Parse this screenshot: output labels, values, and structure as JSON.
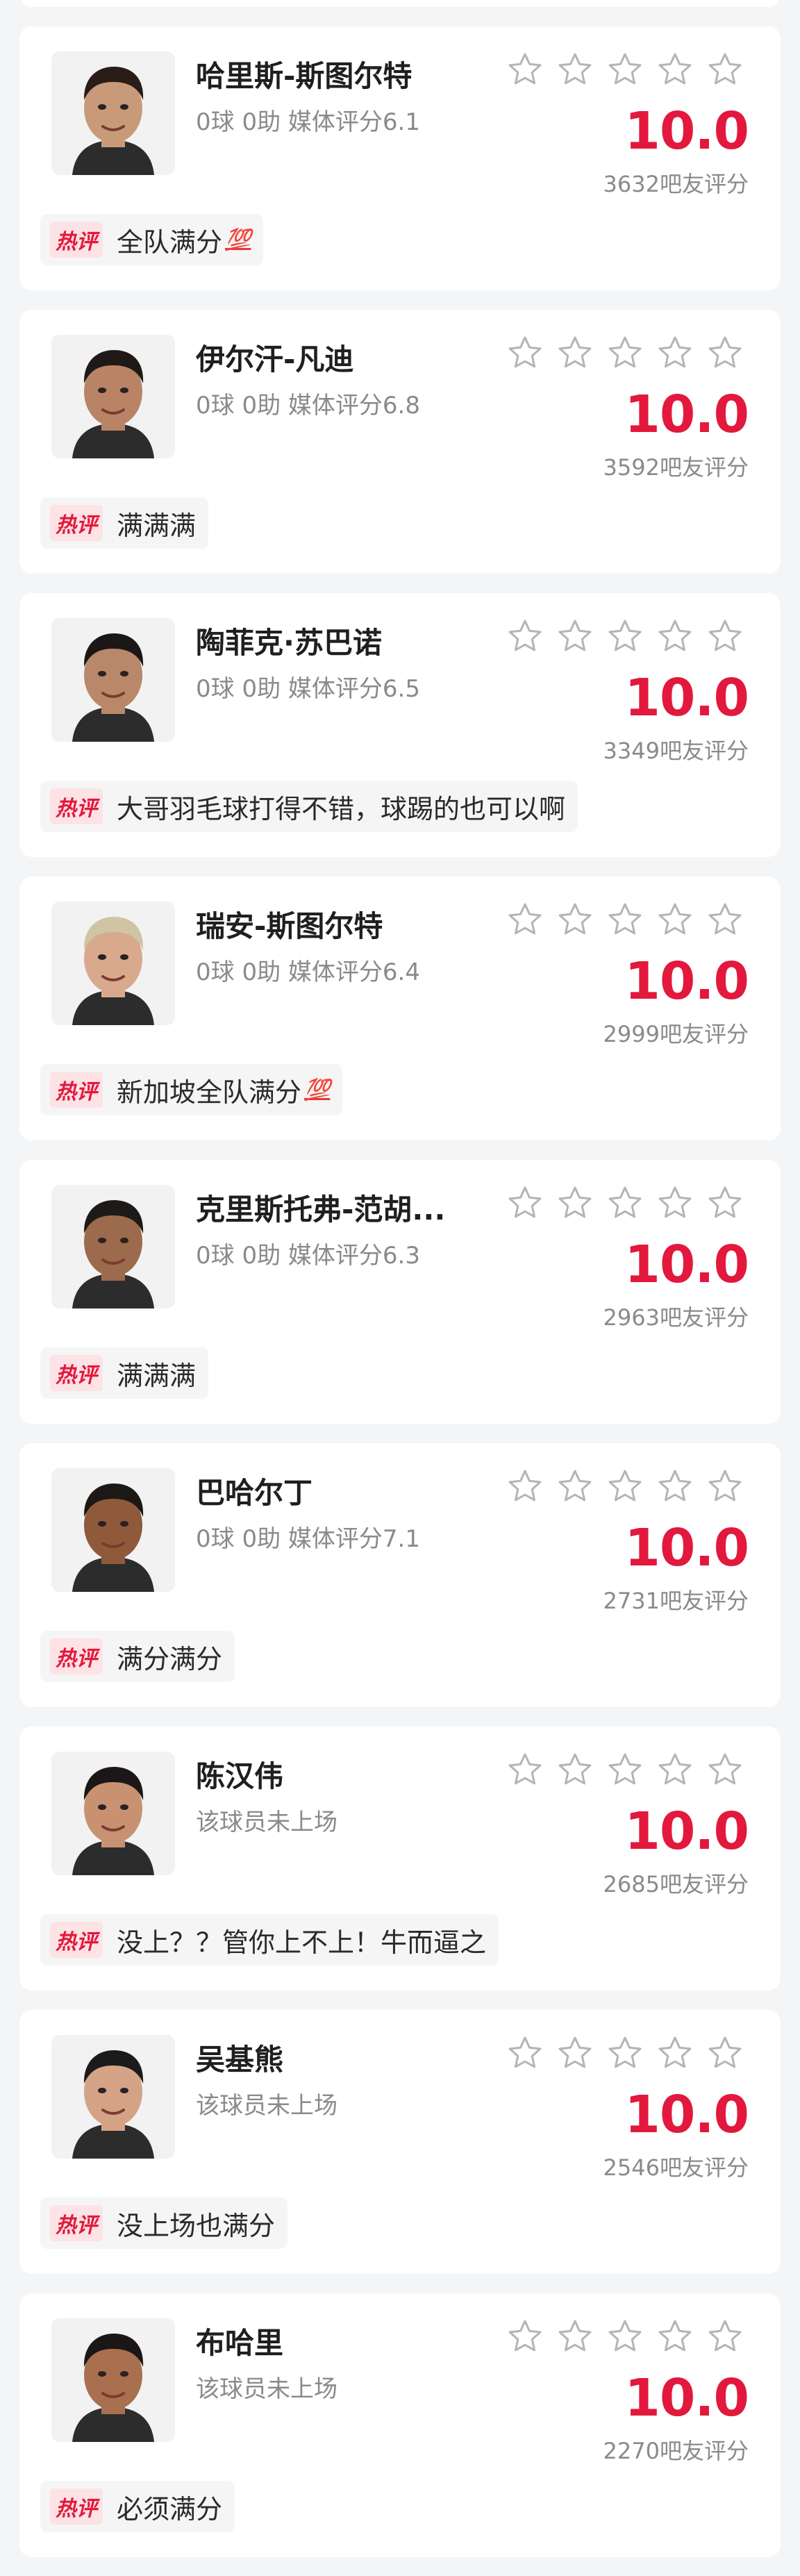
{
  "colors": {
    "accent": "#e3183d",
    "hot_tag_bg": "#fde3e5",
    "page_bg": "#f4f5f7"
  },
  "hot_tag_label": "热评",
  "players": [
    {
      "name": "哈里斯-斯图尔特",
      "stats": "0球 0助  媒体评分6.1",
      "score": "10.0",
      "votes": "3632吧友评分",
      "comment": "全队满分",
      "emoji": "💯",
      "stars_filled": 0
    },
    {
      "name": "伊尔汗-凡迪",
      "stats": "0球 0助  媒体评分6.8",
      "score": "10.0",
      "votes": "3592吧友评分",
      "comment": "满满满",
      "emoji": "",
      "stars_filled": 0
    },
    {
      "name": "陶菲克·苏巴诺",
      "stats": "0球 0助  媒体评分6.5",
      "score": "10.0",
      "votes": "3349吧友评分",
      "comment": "大哥羽毛球打得不错，球踢的也可以啊",
      "emoji": "",
      "stars_filled": 0
    },
    {
      "name": "瑞安-斯图尔特",
      "stats": "0球 0助  媒体评分6.4",
      "score": "10.0",
      "votes": "2999吧友评分",
      "comment": "新加坡全队满分",
      "emoji": "💯",
      "stars_filled": 0
    },
    {
      "name": "克里斯托弗-范胡...",
      "stats": "0球 0助  媒体评分6.3",
      "score": "10.0",
      "votes": "2963吧友评分",
      "comment": "满满满",
      "emoji": "",
      "stars_filled": 0
    },
    {
      "name": "巴哈尔丁",
      "stats": "0球 0助  媒体评分7.1",
      "score": "10.0",
      "votes": "2731吧友评分",
      "comment": "满分满分",
      "emoji": "",
      "stars_filled": 0
    },
    {
      "name": "陈汉伟",
      "stats": "该球员未上场",
      "score": "10.0",
      "votes": "2685吧友评分",
      "comment": "没上？？管你上不上！牛而逼之",
      "emoji": "",
      "stars_filled": 0
    },
    {
      "name": "吴基熊",
      "stats": "该球员未上场",
      "score": "10.0",
      "votes": "2546吧友评分",
      "comment": "没上场也满分",
      "emoji": "",
      "stars_filled": 0
    },
    {
      "name": "布哈里",
      "stats": "该球员未上场",
      "score": "10.0",
      "votes": "2270吧友评分",
      "comment": "必须满分",
      "emoji": "",
      "stars_filled": 0
    }
  ]
}
